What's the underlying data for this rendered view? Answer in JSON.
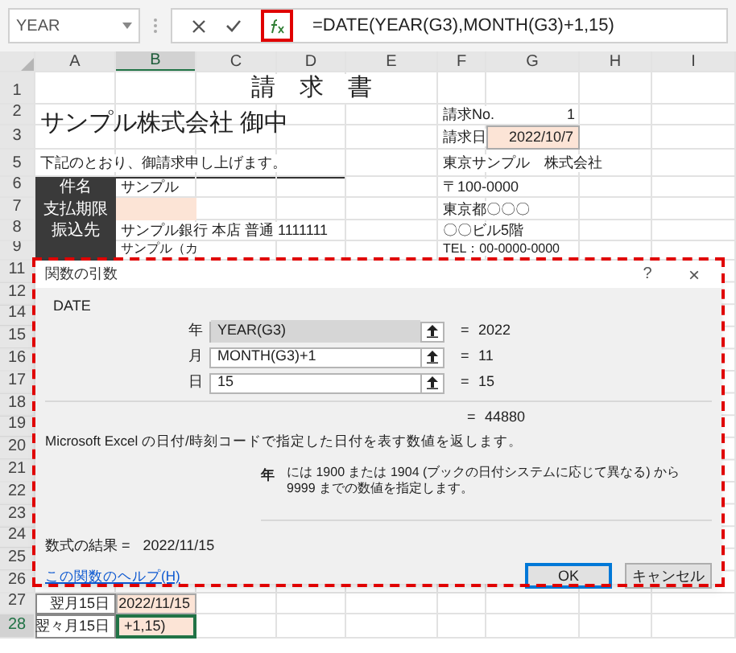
{
  "formula_bar": {
    "name_box": "YEAR",
    "fx_highlighted": true,
    "formula": "=DATE(YEAR(G3),MONTH(G3)+1,15)"
  },
  "columns": [
    {
      "label": "A",
      "selected": false
    },
    {
      "label": "B",
      "selected": true
    },
    {
      "label": "C",
      "selected": false
    },
    {
      "label": "D",
      "selected": false
    },
    {
      "label": "E",
      "selected": false
    },
    {
      "label": "F",
      "selected": false
    },
    {
      "label": "G",
      "selected": false
    },
    {
      "label": "H",
      "selected": false
    },
    {
      "label": "I",
      "selected": false
    }
  ],
  "rows": [
    {
      "label": "1",
      "selected": false,
      "cells": {
        "D": {
          "kind": "title",
          "text": "請　求　書"
        }
      }
    },
    {
      "label": "2",
      "selected": false,
      "cells": {
        "A": {
          "kind": "company",
          "text": "サンプル株式会社 御中"
        },
        "F": {
          "kind": "text",
          "text": "請求No."
        },
        "G": {
          "kind": "number",
          "text": "1"
        }
      }
    },
    {
      "label": "3",
      "selected": false,
      "cells": {
        "F": {
          "kind": "text",
          "text": "請求日"
        },
        "G": {
          "kind": "filled",
          "text": "2022/10/7"
        }
      }
    },
    {
      "label": "5",
      "selected": false,
      "cells": {
        "A": {
          "kind": "text",
          "text": "下記のとおり、御請求申し上げます。"
        },
        "F": {
          "kind": "text",
          "text": "東京サンプル　株式会社"
        }
      }
    },
    {
      "label": "6",
      "selected": false,
      "cells": {
        "A": {
          "kind": "dark",
          "text": "件名"
        },
        "B": {
          "kind": "text",
          "text": "サンプル"
        },
        "F": {
          "kind": "text",
          "text": "〒100-0000"
        }
      }
    },
    {
      "label": "7",
      "selected": false,
      "cells": {
        "A": {
          "kind": "dark",
          "text": "支払期限"
        },
        "B": {
          "kind": "blank_filled"
        },
        "F": {
          "kind": "text",
          "text": "東京都〇〇〇"
        }
      }
    },
    {
      "label": "8",
      "selected": false,
      "cells": {
        "A": {
          "kind": "dark",
          "text": "振込先"
        },
        "B": {
          "kind": "text",
          "text": "サンプル銀行 本店 普通 1111111"
        },
        "F": {
          "kind": "text",
          "text": "〇〇ビル5階"
        }
      }
    },
    {
      "label": "9",
      "selected": false,
      "cells": {
        "A": {
          "kind": "dark_blank"
        },
        "B": {
          "kind": "small",
          "text": "サンプル（カ"
        },
        "F": {
          "kind": "small",
          "text": "TEL：00-0000-0000"
        }
      }
    },
    {
      "label": "11",
      "selected": false
    },
    {
      "label": "12",
      "selected": false
    },
    {
      "label": "14",
      "selected": false
    },
    {
      "label": "15",
      "selected": false
    },
    {
      "label": "16",
      "selected": false
    },
    {
      "label": "17",
      "selected": false
    },
    {
      "label": "18",
      "selected": false
    },
    {
      "label": "19",
      "selected": false
    },
    {
      "label": "20",
      "selected": false
    },
    {
      "label": "21",
      "selected": false
    },
    {
      "label": "22",
      "selected": false
    },
    {
      "label": "23",
      "selected": false
    },
    {
      "label": "24",
      "selected": false
    },
    {
      "label": "25",
      "selected": false
    },
    {
      "label": "26",
      "selected": false
    },
    {
      "label": "27",
      "selected": false,
      "cells": {
        "A": {
          "kind": "right",
          "text": "翌月15日"
        },
        "B": {
          "kind": "filled",
          "text": "2022/11/15"
        }
      }
    },
    {
      "label": "28",
      "selected": true,
      "cells": {
        "A": {
          "kind": "right",
          "text": "翌々月15日"
        },
        "B": {
          "kind": "active",
          "text": "+1,15)"
        }
      }
    }
  ],
  "dialog": {
    "title": "関数の引数",
    "help": "?",
    "close": "×",
    "highlighted": true,
    "function": "DATE",
    "arguments": [
      {
        "label": "年",
        "value": "YEAR(G3)",
        "selected": true,
        "equals": "=",
        "result": "2022"
      },
      {
        "label": "月",
        "value": "MONTH(G3)+1",
        "selected": false,
        "equals": "=",
        "result": "11"
      },
      {
        "label": "日",
        "value": "15",
        "selected": false,
        "equals": "=",
        "result": "15"
      }
    ],
    "total_equals": "=",
    "total": "44880",
    "description": "Microsoft Excel の日付/時刻コードで指定した日付を表す数値を返します。",
    "argument_name": "年",
    "argument_help": "には 1900 または 1904 (ブックの日付システムに応じて異なる) から 9999 までの数値を指定します。",
    "result_label": "数式の結果 =",
    "result": "2022/11/15",
    "help_link": "この関数のヘルプ(H)",
    "buttons": [
      {
        "label": "OK",
        "default": true
      },
      {
        "label": "キャンセル",
        "default": false
      }
    ]
  }
}
